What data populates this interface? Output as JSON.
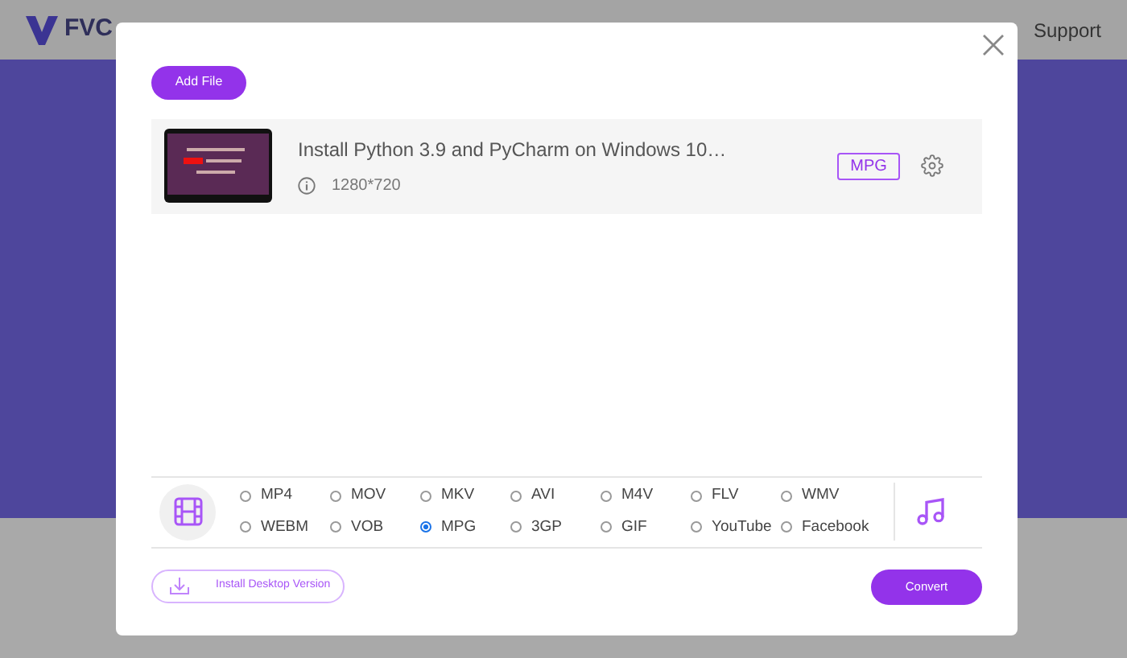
{
  "header": {
    "logo": "FVC",
    "support": "Support"
  },
  "dialog": {
    "add_file": "Add File",
    "file": {
      "title": "Install Python 3.9 and PyCharm on Windows 10…",
      "resolution": "1280*720",
      "format": "MPG"
    },
    "formats": [
      {
        "label": "MP4",
        "selected": false
      },
      {
        "label": "MOV",
        "selected": false
      },
      {
        "label": "MKV",
        "selected": false
      },
      {
        "label": "AVI",
        "selected": false
      },
      {
        "label": "M4V",
        "selected": false
      },
      {
        "label": "FLV",
        "selected": false
      },
      {
        "label": "WMV",
        "selected": false
      },
      {
        "label": "WEBM",
        "selected": false
      },
      {
        "label": "VOB",
        "selected": false
      },
      {
        "label": "MPG",
        "selected": true
      },
      {
        "label": "3GP",
        "selected": false
      },
      {
        "label": "GIF",
        "selected": false
      },
      {
        "label": "YouTube",
        "selected": false
      },
      {
        "label": "Facebook",
        "selected": false
      }
    ],
    "install": "Install Desktop Version",
    "convert": "Convert"
  }
}
